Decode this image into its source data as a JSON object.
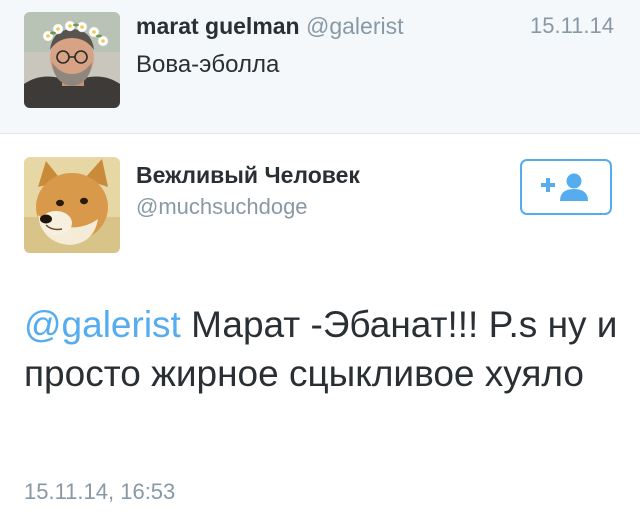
{
  "parent_tweet": {
    "name": "marat guelman",
    "handle": "@galerist",
    "timestamp": "15.11.14",
    "text": "Вова-эболла"
  },
  "main_tweet": {
    "name": "Вежливый Человек",
    "handle": "@muchsuchdoge",
    "mention": "@galerist",
    "text": " Марат -Эбанат!!! P.s ну и просто жирное сцыкливое хуяло",
    "timestamp": "15.11.14, 16:53",
    "follow_icon": "add-user-icon"
  },
  "colors": {
    "accent": "#55acee",
    "text": "#292f33",
    "muted": "#8899a6",
    "parent_bg": "#f5f8fa"
  }
}
